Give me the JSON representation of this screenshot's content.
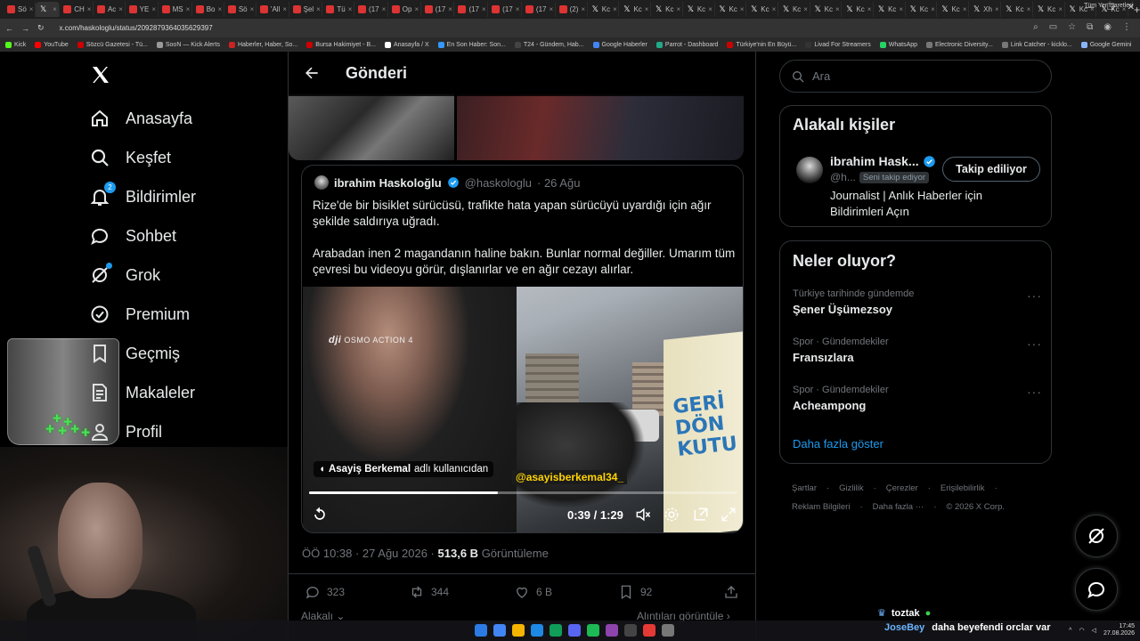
{
  "browser": {
    "tabs": [
      {
        "label": "Sö",
        "color": "#d33"
      },
      {
        "label": "",
        "color": "x",
        "active": true
      },
      {
        "label": "CH",
        "color": "#d33"
      },
      {
        "label": "Ac",
        "color": "#d33"
      },
      {
        "label": "YE",
        "color": "#d33"
      },
      {
        "label": "MS",
        "color": "#d33"
      },
      {
        "label": "Bo",
        "color": "#d33"
      },
      {
        "label": "Sö",
        "color": "#d33"
      },
      {
        "label": "'All",
        "color": "#d33"
      },
      {
        "label": "Şel",
        "color": "#d33"
      },
      {
        "label": "Tü",
        "color": "#d33"
      },
      {
        "label": "(17",
        "color": "#d33"
      },
      {
        "label": "Op",
        "color": "#d33"
      },
      {
        "label": "(17",
        "color": "#d33"
      },
      {
        "label": "(17",
        "color": "#d33"
      },
      {
        "label": "(17",
        "color": "#d33"
      },
      {
        "label": "(17",
        "color": "#d33"
      },
      {
        "label": "(2)",
        "color": "#d33"
      },
      {
        "label": "Kc",
        "color": "x"
      },
      {
        "label": "Kc",
        "color": "x"
      },
      {
        "label": "Kc",
        "color": "x"
      },
      {
        "label": "Kc",
        "color": "x"
      },
      {
        "label": "Kc",
        "color": "x"
      },
      {
        "label": "Kc",
        "color": "x"
      },
      {
        "label": "Kc",
        "color": "x"
      },
      {
        "label": "Kc",
        "color": "x"
      },
      {
        "label": "Kc",
        "color": "x"
      },
      {
        "label": "Kc",
        "color": "x"
      },
      {
        "label": "Kc",
        "color": "x"
      },
      {
        "label": "Kc",
        "color": "x"
      },
      {
        "label": "Xh",
        "color": "x"
      },
      {
        "label": "Kc",
        "color": "x"
      },
      {
        "label": "Kc",
        "color": "x"
      },
      {
        "label": "Kc",
        "color": "x"
      },
      {
        "label": "Kc",
        "color": "x"
      }
    ],
    "url": "x.com/haskologlu/status/2092879364035629397",
    "bookmarks": [
      "Kick",
      "YouTube",
      "Sözcü Gazetesi - Tü...",
      "SooN — Kick Alerts",
      "Haberler, Haber, So...",
      "Bursa Hakimiyet - B...",
      "Anasayfa / X",
      "En Son Haber: Son...",
      "T24 - Gündem, Hab...",
      "Google Haberler",
      "Parrot - Dashboard",
      "Türkiye'nin En Büyü...",
      "Livad For Streamers",
      "WhatsApp",
      "Electronic Diversity...",
      "Link Catcher - kicklo...",
      "Google Gemini"
    ],
    "bookmarks_right": "Tüm Yer İşaretleri"
  },
  "nav": {
    "items": [
      {
        "label": "Anasayfa",
        "icon": "home-icon"
      },
      {
        "label": "Keşfet",
        "icon": "search-icon"
      },
      {
        "label": "Bildirimler",
        "icon": "bell-icon",
        "badge": "2"
      },
      {
        "label": "Sohbet",
        "icon": "chat-icon"
      },
      {
        "label": "Grok",
        "icon": "grok-icon"
      },
      {
        "label": "Premium",
        "icon": "premium-icon"
      },
      {
        "label": "Geçmiş",
        "icon": "bookmark-icon"
      },
      {
        "label": "Makaleler",
        "icon": "articles-icon"
      },
      {
        "label": "Profil",
        "icon": "profile-icon"
      }
    ]
  },
  "main": {
    "title": "Gönderi",
    "quote": {
      "name": "ibrahim Haskoloğlu",
      "handle": "@haskologlu",
      "date": "· 26 Ağu",
      "text1": "Rize'de bir bisiklet sürücüsü, trafikte hata yapan sürücüyü uyardığı için ağır şekilde saldırıya uğradı.",
      "text2": "Arabadan inen 2 magandanın haline bakın. Bunlar normal değiller. Umarım tüm çevresi bu videoyu görür, dışlanırlar ve en ağır cezayı alırlar."
    },
    "video": {
      "dji_brand": "dji",
      "dji_model": "OSMO ACTION 4",
      "booth_text": "GERİ DÖN KUTU",
      "attribution_user": "Asayiş Berkemal",
      "attribution_suffix": "adlı kullanıcıdan",
      "handle_overlay": "@asayisberkemal34_",
      "time": "0:39 / 1:29",
      "progress": 0.44
    },
    "meta": {
      "time": "ÖÖ 10:38 · 27 Ağu 2026 ·",
      "views": "513,6 B",
      "views_label": "Görüntüleme"
    },
    "actions": {
      "replies": "323",
      "reposts": "344",
      "likes": "6 B",
      "bookmarks": "92"
    },
    "below_left": "Alakalı",
    "below_right": "Alıntıları görüntüle"
  },
  "right": {
    "search_placeholder": "Ara",
    "related": {
      "title": "Alakalı kişiler",
      "name": "ibrahim Hask...",
      "handle": "@h...",
      "tag": "Seni takip ediyor",
      "follow_label": "Takip ediliyor",
      "bio": "Journalist | Anlık Haberler için Bildirimleri Açın"
    },
    "trends": {
      "title": "Neler oluyor?",
      "items": [
        {
          "context": "Türkiye tarihinde gündemde",
          "name": "Şener Üşümezsoy"
        },
        {
          "context": "Spor · Gündemdekiler",
          "name": "Fransızlara"
        },
        {
          "context": "Spor · Gündemdekiler",
          "name": "Acheampong"
        }
      ],
      "show_more": "Daha fazla göster"
    },
    "footer": {
      "links": [
        "Şartlar",
        "Gizlilik",
        "Çerezler",
        "Erişilebilirlik",
        "Reklam Bilgileri",
        "Daha fazla ···"
      ],
      "copyright": "© 2026 X Corp."
    }
  },
  "stream_chat": {
    "line1_user": "toztak",
    "line2_user": "JoseBey",
    "line2_text": "daha beyefendi orclar var"
  },
  "taskbar": {
    "time": "17:45",
    "date": "27.08.2026"
  },
  "colors": {
    "accent": "#1d9bf0",
    "background": "#000000",
    "text": "#e7e9ea",
    "muted": "#71767b",
    "border": "#2f3336",
    "overlay_yellow": "#ffd400"
  }
}
